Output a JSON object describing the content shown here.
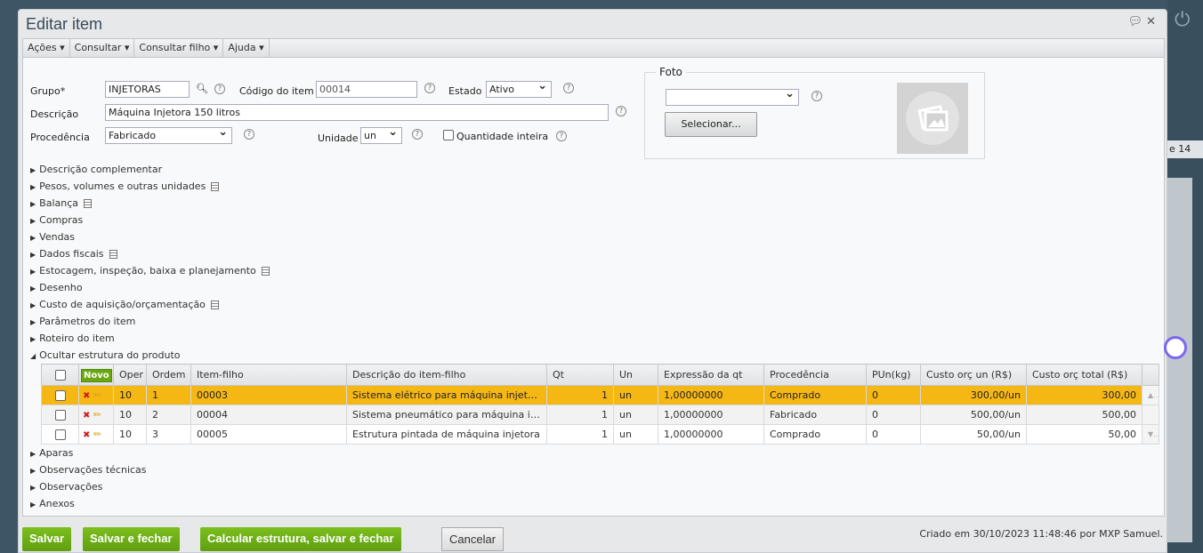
{
  "dialog": {
    "title": "Editar item"
  },
  "menu": [
    "Ações",
    "Consultar",
    "Consultar filho",
    "Ajuda"
  ],
  "form": {
    "grupo_label": "Grupo*",
    "grupo_value": "INJETORAS",
    "codigo_label": "Código do item",
    "codigo_value": "00014",
    "estado_label": "Estado",
    "estado_value": "Ativo",
    "descricao_label": "Descrição",
    "descricao_value": "Máquina Injetora 150 litros",
    "procedencia_label": "Procedência",
    "procedencia_value": "Fabricado",
    "unidade_label": "Unidade",
    "unidade_value": "un",
    "qtd_inteira_label": "Quantidade inteira"
  },
  "foto": {
    "legend": "Foto",
    "select_value": "",
    "button": "Selecionar..."
  },
  "sections": [
    "Descrição complementar",
    "Pesos, volumes e outras unidades",
    "Balança",
    "Compras",
    "Vendas",
    "Dados fiscais",
    "Estocagem, inspeção, baixa e planejamento",
    "Desenho",
    "Custo de aquisição/orçamentação",
    "Parâmetros do item",
    "Roteiro do item",
    "Ocultar estrutura do produto"
  ],
  "sections_after": [
    "Aparas",
    "Observações técnicas",
    "Observações",
    "Anexos"
  ],
  "table": {
    "novo": "Novo",
    "headers": [
      "Oper",
      "Ordem",
      "Item-filho",
      "Descrição do item-filho",
      "Qt",
      "Un",
      "Expressão da qt",
      "Procedência",
      "PUn(kg)",
      "Custo orç un (R$)",
      "Custo orç total (R$)"
    ],
    "rows": [
      [
        "10",
        "1",
        "00003",
        "Sistema elétrico para máquina injetora",
        "1",
        "un",
        "1,00000000",
        "Comprado",
        "0",
        "300,00/un",
        "300,00"
      ],
      [
        "10",
        "2",
        "00004",
        "Sistema pneumático para máquina in...",
        "1",
        "un",
        "1,00000000",
        "Fabricado",
        "0",
        "500,00/un",
        "500,00"
      ],
      [
        "10",
        "3",
        "00005",
        "Estrutura pintada de máquina injetora",
        "1",
        "un",
        "1,00000000",
        "Comprado",
        "0",
        "50,00/un",
        "50,00"
      ]
    ]
  },
  "buttons": {
    "salvar": "Salvar",
    "salvar_fechar": "Salvar e fechar",
    "calcular": "Calcular estrutura, salvar e fechar",
    "cancelar": "Cancelar"
  },
  "footer": "Criado em 30/10/2023 11:48:46 por MXP Samuel.",
  "background": {
    "page_fragment": "e 14"
  }
}
